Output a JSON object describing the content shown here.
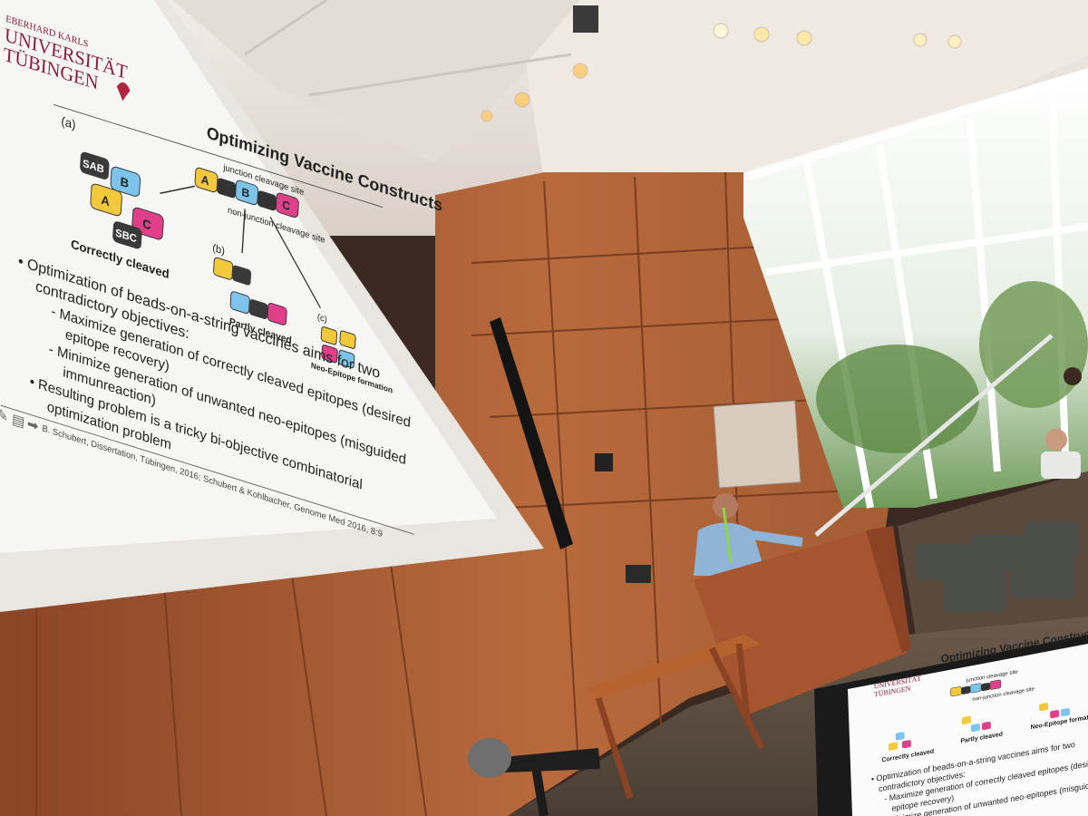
{
  "slide": {
    "university_logo": [
      "EBERHARD KARLS",
      "UNIVERSITÄT",
      "TÜBINGEN"
    ],
    "title": "Optimizing Vaccine Constructs",
    "diagram": {
      "label_a": "(a)",
      "label_b": "(b)",
      "label_c": "(c)",
      "junction_site": "junction cleavage site",
      "nonjunction_site": "non-junction cleavage site",
      "correctly_cleaved": "Correctly cleaved",
      "partly_cleaved": "Partly cleaved",
      "neo_epitope": "Neo-Epitope formation",
      "block_a": "A",
      "block_b": "B",
      "block_c": "C",
      "block_sab": "SAB",
      "block_sbc": "SBC"
    },
    "bullets": [
      "• Optimization of beads-on-a-string vaccines aims for two",
      "contradictory objectives:",
      "- Maximize generation of correctly cleaved epitopes (desired",
      "epitope recovery)",
      "- Minimize generation of unwanted neo-epitopes (misguided",
      "immunreaction)",
      "• Resulting problem is a tricky bi-objective combinatorial",
      "optimization problem"
    ],
    "citation": "B. Schubert, Dissertation, Tübingen, 2016; Schubert & Kohlbacher, Genome Med 2016, 8:9"
  },
  "monitor": {
    "title": "Optimizing Vaccine Constructs",
    "logo": [
      "UNIVERSITÄT",
      "TÜBINGEN"
    ],
    "junction_site": "junction cleavage site",
    "nonjunction_site": "non-junction cleavage site",
    "correctly_cleaved": "Correctly cleaved",
    "partly_cleaved": "Partly cleaved",
    "neo_epitope": "Neo-Epitope formation",
    "lines": [
      "• Optimization of beads-on-a-string vaccines aims for two",
      "contradictory objectives:",
      "- Maximize generation of correctly cleaved epitopes (desire",
      "epitope recovery)",
      "- Minimize generation of unwanted neo-epitopes (misguid"
    ]
  },
  "colors": {
    "block_a": "#f2c93a",
    "block_b": "#7cc4ec",
    "block_c": "#e0408a",
    "block_s": "#3a3a3a",
    "wood": "#b5643a",
    "ceiling": "#e8e2da",
    "slide_bg": "#f4f4f4"
  }
}
